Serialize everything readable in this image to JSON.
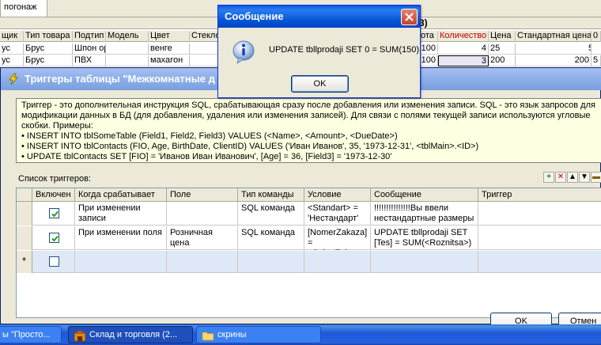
{
  "background": {
    "tab": "погонаж",
    "headers_left": [
      "щик",
      "Тип товара",
      "Подтип",
      "Модель",
      "Цвет",
      "Стекло"
    ],
    "headers_right": [
      "ота",
      "Количество",
      "Цена",
      "Стандартная цена",
      "0"
    ],
    "rows": [
      {
        "c0": "ус",
        "type": "Брус",
        "subtype": "Шпон ор",
        "model": "",
        "color": "венге",
        "r0": "100",
        "qty": "4",
        "price": "25",
        "std": "5"
      },
      {
        "c0": "ус",
        "type": "Брус",
        "subtype": "ПВХ",
        "model": "",
        "color": "махагон",
        "r0": "100",
        "qty": "3",
        "price": "200",
        "std": "200",
        "last": "5"
      }
    ],
    "bracket": "3)"
  },
  "trigger_window": {
    "title": "Триггеры таблицы \"Межкомнатные д",
    "info_lines": [
      "Триггер - это дополнительная инструкция SQL, срабатывающая сразу после добавления или изменения записи. SQL - это язык запросов для",
      "модификации данных в БД (для добавления, удаления или изменения записей). Для связи с полями текущей записи используются угловые",
      "скобки. Примеры:",
      "• INSERT INTO tblSomeTable (Field1, Field2, Field3) VALUES (<Name>, <Amount>, <DueDate>)",
      "• INSERT INTO tblContacts (FIO, Age, BirthDate, ClientID) VALUES ('Иван Иванов', 35, '1973-12-31', <tblMain>.<ID>)",
      "• UPDATE tblContacts SET [FIO] = 'Иванов Иван Иванович', [Age] = 36, [Field3] = '1973-12-30'"
    ],
    "list_label": "Список триггеров:",
    "columns": [
      "Включен",
      "Когда срабатывает",
      "Поле",
      "Тип команды",
      "Условие",
      "Сообщение",
      "Триггер"
    ],
    "rows": [
      {
        "when": "При изменении записи",
        "field": "",
        "cmd": "SQL команда",
        "cond": "<Standart> = 'Нестандарт'",
        "msg": "!!!!!!!!!!!!!!!Вы ввели нестандартные размеры",
        "trig": ""
      },
      {
        "when": "При изменении поля",
        "field": "Розничная цена",
        "cmd": "SQL команда",
        "cond": "[NomerZakaza] = <SchetZakaz>",
        "msg": "UPDATE tbllprodaji SET [Tes] = SUM(<Roznitsa>)",
        "trig": ""
      }
    ],
    "new_row_marker": "*",
    "ok_label": "OK",
    "cancel_label": "Отмен"
  },
  "message_box": {
    "title": "Сообщение",
    "text": "UPDATE tbllprodaji SET 0 = SUM(150)",
    "ok_label": "OK"
  },
  "taskbar": {
    "items": [
      "ы \"Просто...",
      "Склад и торговля (2...",
      "скрины"
    ]
  },
  "colors": {
    "xp_blue": "#0553d4",
    "inactive_title": "#8fb0ea",
    "info_bg": "#ffffe1",
    "selection": "#dfe8f6",
    "accent_red": "#c00000"
  }
}
